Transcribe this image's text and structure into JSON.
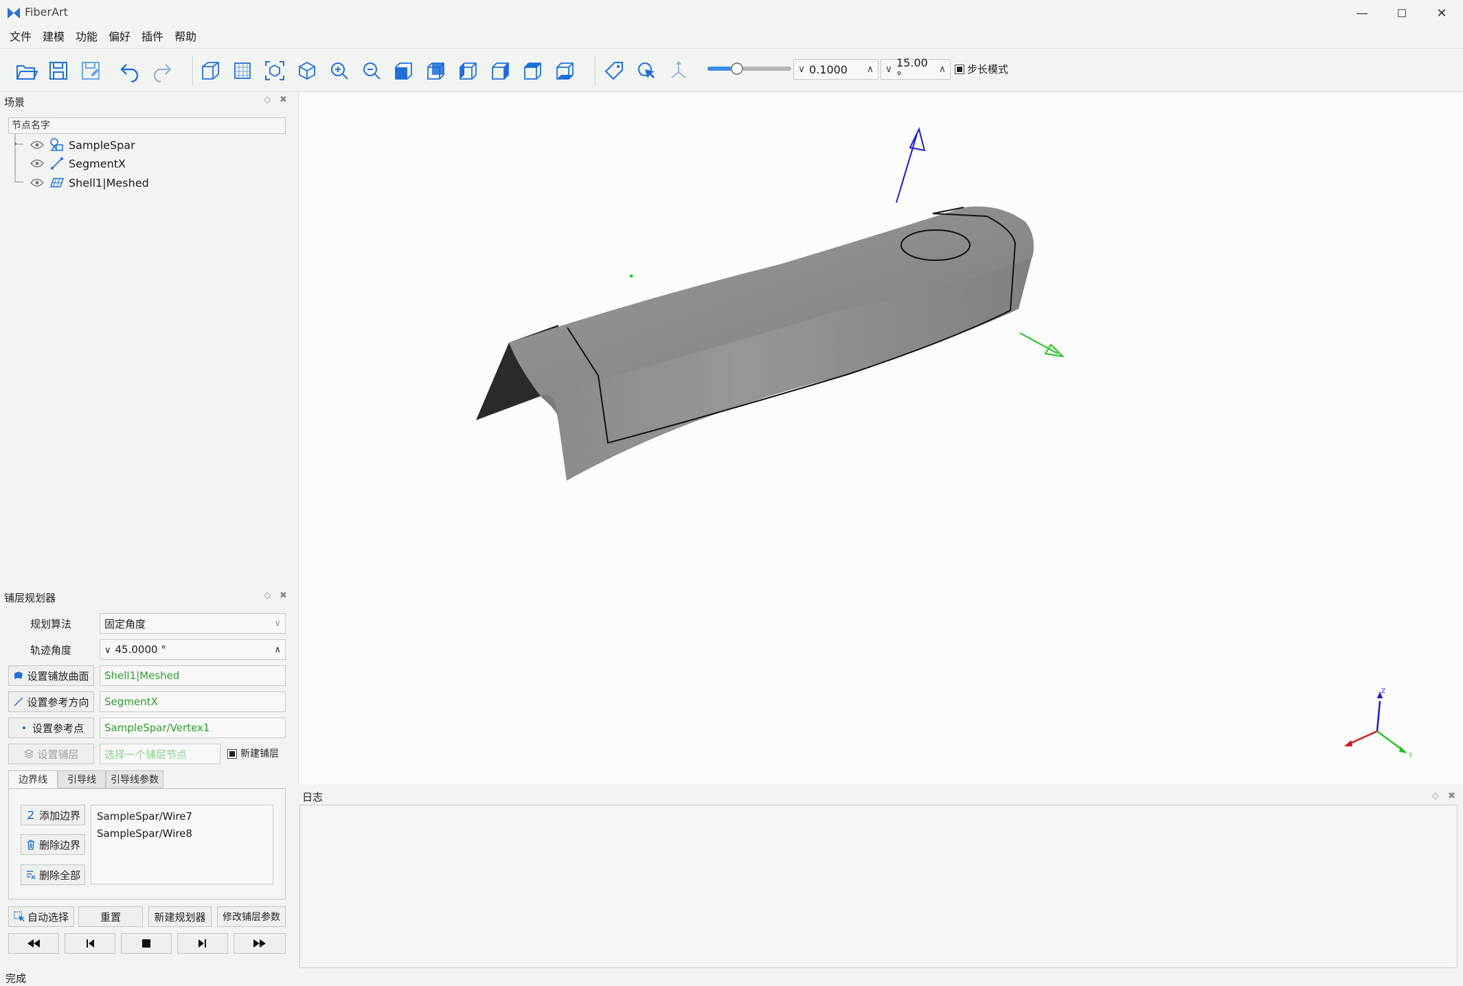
{
  "app": {
    "title": "FiberArt"
  },
  "window_controls": {
    "minimize": "—",
    "maximize": "☐",
    "close": "✕"
  },
  "menu": [
    "文件",
    "建模",
    "功能",
    "偏好",
    "插件",
    "帮助"
  ],
  "toolbar": {
    "icons": [
      "open-icon",
      "save-icon",
      "save-as-icon",
      "undo-icon",
      "redo-icon",
      "box-view-icon",
      "section-view-icon",
      "fit-view-icon",
      "iso-view-icon",
      "zoom-in-icon",
      "zoom-out-icon",
      "front-view-icon",
      "back-view-icon",
      "left-view-icon",
      "right-view-icon",
      "top-view-icon",
      "bottom-view-icon",
      "tag-icon",
      "pick-icon",
      "axes-icon"
    ],
    "step_slider_value": 0.35,
    "step_value": "0.1000",
    "angle_value": "15.00 °",
    "step_mode_label": "步长模式",
    "step_mode_checked": true
  },
  "scene_panel": {
    "title": "场景",
    "column_header": "节点名字",
    "nodes": [
      {
        "name": "SampleSpar",
        "icon": "assembly-icon"
      },
      {
        "name": "SegmentX",
        "icon": "segment-icon"
      },
      {
        "name": "Shell1|Meshed",
        "icon": "mesh-icon"
      }
    ]
  },
  "planner_panel": {
    "title": "铺层规划器",
    "algorithm_label": "规划算法",
    "algorithm_value": "固定角度",
    "angle_label": "轨迹角度",
    "angle_value": "45.0000 °",
    "set_surface_button": "设置铺放曲面",
    "surface_value": "Shell1|Meshed",
    "set_direction_button": "设置参考方向",
    "direction_value": "SegmentX",
    "set_point_button": "设置参考点",
    "point_value": "SampleSpar/Vertex1",
    "set_layer_button": "设置铺层",
    "layer_placeholder": "选择一个铺层节点",
    "new_layer_label": "新建铺层",
    "new_layer_checked": true,
    "tabs": [
      "边界线",
      "引导线",
      "引导线参数"
    ],
    "add_boundary_button": "添加边界",
    "delete_boundary_button": "删除边界",
    "delete_all_button": "删除全部",
    "boundaries": [
      "SampleSpar/Wire7",
      "SampleSpar/Wire8"
    ],
    "auto_select_button": "自动选择",
    "reset_button": "重置",
    "new_planner_button": "新建规划器",
    "modify_params_button": "修改铺层参数"
  },
  "viewport": {
    "axis_labels": {
      "z": "Z",
      "y": "Y"
    },
    "colors": {
      "z_axis": "#1a1ad0",
      "y_axis": "#22c322",
      "x_axis": "#d01a1a",
      "part": "#8a8a8a"
    }
  },
  "log_panel": {
    "title": "日志"
  },
  "status_bar": {
    "text": "完成"
  }
}
